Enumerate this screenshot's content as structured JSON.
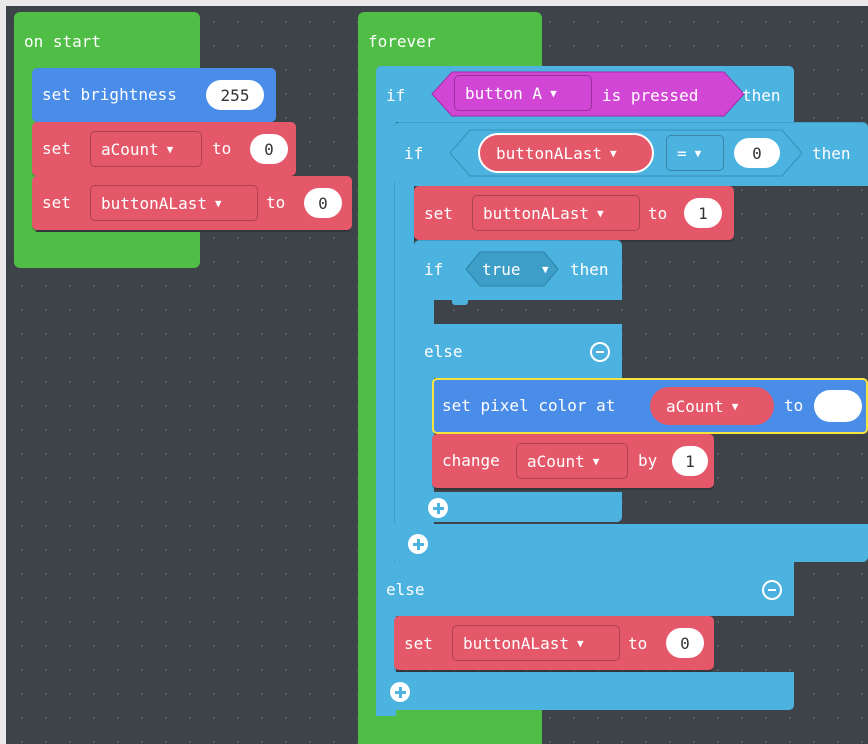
{
  "on_start": {
    "label": "on start",
    "set_brightness": {
      "label": "set brightness",
      "value": "255"
    },
    "set_acount": {
      "set": "set",
      "variable": "aCount",
      "to": "to",
      "value": "0"
    },
    "set_buttonalast": {
      "set": "set",
      "variable": "buttonALast",
      "to": "to",
      "value": "0"
    }
  },
  "forever": {
    "label": "forever",
    "if_outer": {
      "if": "if",
      "button": "button A",
      "is_pressed": "is pressed",
      "then": "then"
    },
    "if_inner": {
      "if": "if",
      "variable": "buttonALast",
      "operator": "=",
      "value": "0",
      "then": "then"
    },
    "set_buttonalast_1": {
      "set": "set",
      "variable": "buttonALast",
      "to": "to",
      "value": "1"
    },
    "if_true": {
      "if": "if",
      "condition": "true",
      "then": "then"
    },
    "else_inner": "else",
    "set_pixel": {
      "label": "set pixel color at",
      "variable": "aCount",
      "to": "to",
      "color": "#ffffff"
    },
    "change_acount": {
      "change": "change",
      "variable": "aCount",
      "by": "by",
      "value": "1"
    },
    "else_outer": "else",
    "set_buttonalast_0": {
      "set": "set",
      "variable": "buttonALast",
      "to": "to",
      "value": "0"
    }
  },
  "colors": {
    "events": "#4fbd46",
    "logic": "#4cb2df",
    "variables": "#e5586a",
    "basic": "#4a8de8",
    "input": "#d246d6",
    "workspace": "#3e4249"
  }
}
